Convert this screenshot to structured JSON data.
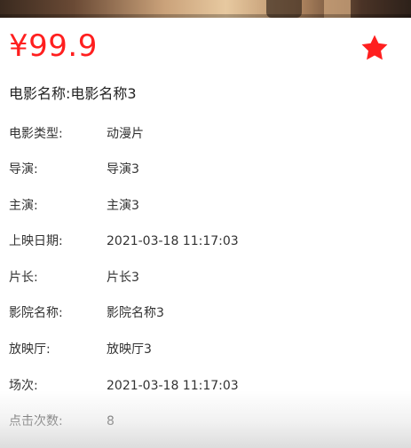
{
  "movie": {
    "price": "¥99.9",
    "name_label": "电影名称:",
    "name_value": "电影名称3",
    "favorite_color": "#ff1f1f",
    "details": [
      {
        "label": "电影类型:",
        "value": "动漫片"
      },
      {
        "label": "导演:",
        "value": "导演3"
      },
      {
        "label": "主演:",
        "value": "主演3"
      },
      {
        "label": "上映日期:",
        "value": "2021-03-18 11:17:03"
      },
      {
        "label": "片长:",
        "value": "片长3"
      },
      {
        "label": "影院名称:",
        "value": "影院名称3"
      },
      {
        "label": "放映厅:",
        "value": "放映厅3"
      },
      {
        "label": "场次:",
        "value": "2021-03-18 11:17:03"
      },
      {
        "label": "点击次数:",
        "value": "8"
      }
    ]
  },
  "icons": {
    "favorite": "star-icon"
  }
}
